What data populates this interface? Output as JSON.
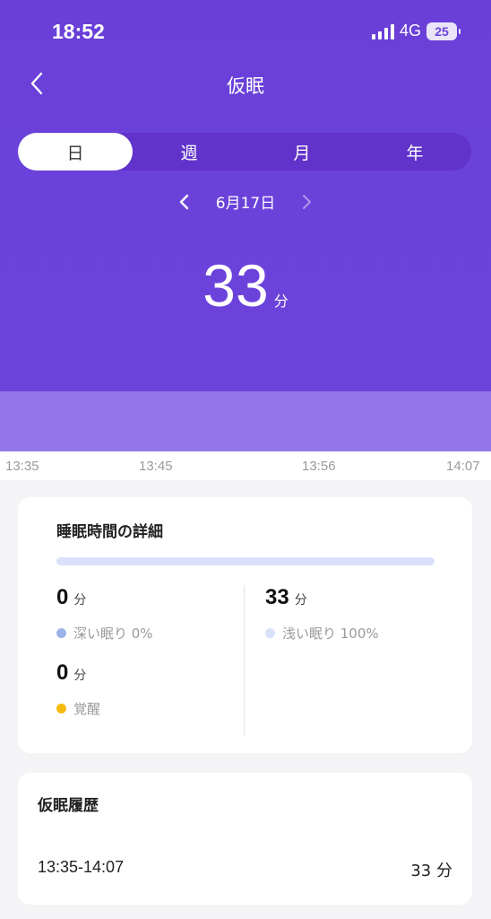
{
  "status": {
    "time": "18:52",
    "network": "4G",
    "battery": "25"
  },
  "header": {
    "title": "仮眠",
    "back_icon": "chevron-left-icon"
  },
  "tabs": [
    {
      "label": "日",
      "active": true
    },
    {
      "label": "週",
      "active": false
    },
    {
      "label": "月",
      "active": false
    },
    {
      "label": "年",
      "active": false
    }
  ],
  "date": {
    "label": "6月17日"
  },
  "summary": {
    "value": "33",
    "unit": "分"
  },
  "timeline": [
    "13:35",
    "13:45",
    "13:56",
    "14:07"
  ],
  "details": {
    "title": "睡眠時間の詳細",
    "deep": {
      "value": "0",
      "unit": "分",
      "label": "深い眠り 0%",
      "color": "#9db3ea"
    },
    "light": {
      "value": "33",
      "unit": "分",
      "label": "浅い眠り 100%",
      "color": "#d9e2fa"
    },
    "awake": {
      "value": "0",
      "unit": "分",
      "label": "覚醒",
      "color": "#f6b90f"
    }
  },
  "history": {
    "title": "仮眠履歴",
    "entries": [
      {
        "time": "13:35-14:07",
        "duration": "33 分"
      }
    ]
  },
  "colors": {
    "header": "#6b44dc",
    "band": "#9475ea",
    "accent": "#ffffff"
  }
}
